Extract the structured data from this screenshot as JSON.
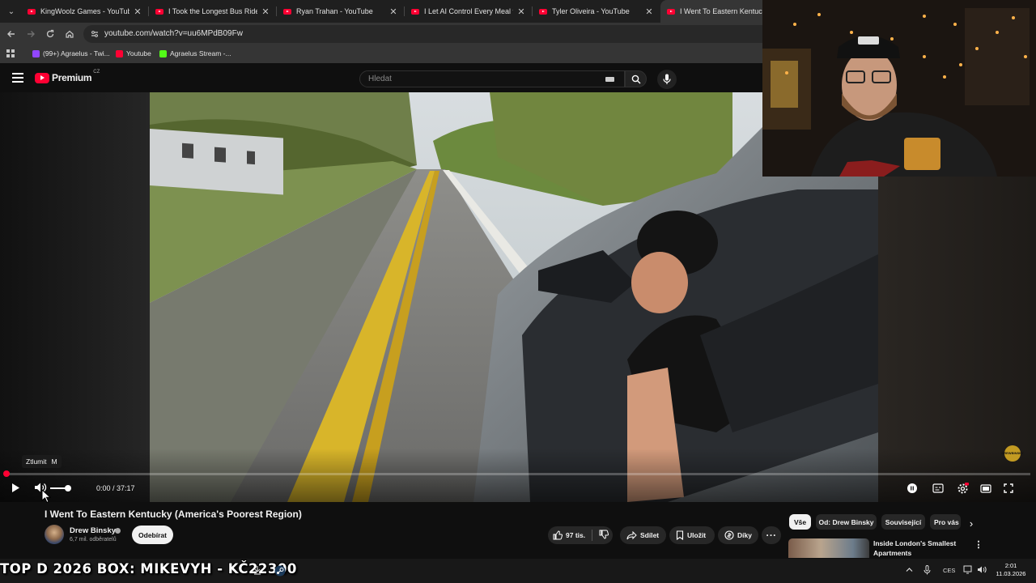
{
  "browser": {
    "tabs": [
      {
        "label": "KingWoolz Games - YouTube"
      },
      {
        "label": "I Took the Longest Bus Ride in"
      },
      {
        "label": "Ryan Trahan - YouTube"
      },
      {
        "label": "I Let AI Control Every Meal for"
      },
      {
        "label": "Tyler Oliveira - YouTube"
      },
      {
        "label": "I Went To Eastern Kentucky (A"
      }
    ],
    "url": "youtube.com/watch?v=uu6MPdB09Fw",
    "bookmarks": [
      {
        "label": "(99+) Agraelus - Twi...",
        "color": "#9146ff"
      },
      {
        "label": "Youtube",
        "color": "#ff0033"
      },
      {
        "label": "Agraelus Stream -...",
        "color": "#53fc18"
      }
    ]
  },
  "youtube": {
    "logo_text": "Premium",
    "logo_country": "CZ",
    "search_placeholder": "Hledat"
  },
  "player": {
    "tooltip_label": "Ztlumit",
    "tooltip_key": "M",
    "time": "0:00 / 37:17",
    "progress_fraction": 0.0,
    "volume_fraction": 0.9,
    "watermark": "DREW BINSKY",
    "accent": "#ff0033"
  },
  "video": {
    "title": "I Went To Eastern Kentucky (America's Poorest Region)",
    "channel": "Drew Binsky",
    "subscribers": "6,7 mil. odběratelů",
    "subscribe_label": "Odebírat",
    "likes": "97 tis.",
    "share_label": "Sdílet",
    "save_label": "Uložit",
    "thanks_label": "Díky"
  },
  "sidebar": {
    "chips": [
      "Vše",
      "Od: Drew Binsky",
      "Související",
      "Pro vás"
    ],
    "recommendation_title": "Inside London's Smallest Apartments"
  },
  "overlay": {
    "banner": "TOP D 2026 BOX: MIKEVYH - KČ22300"
  },
  "taskbar": {
    "language": "CES",
    "time": "2:01",
    "date": "11.03.2026"
  }
}
